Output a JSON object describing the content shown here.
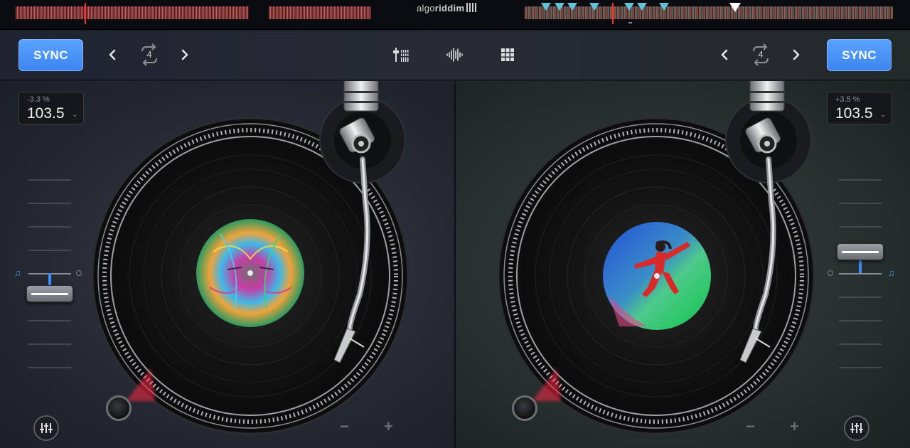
{
  "app": {
    "brand_light": "algo",
    "brand_bold": "riddim"
  },
  "colors": {
    "accent": "#3f8ef5",
    "sync": "#4a94fa",
    "playhead": "#ff2b2b",
    "cue": "#5fc4d8"
  },
  "left_deck": {
    "sync_label": "SYNC",
    "loop_value": "4",
    "pitch_percent": "-3.3 %",
    "bpm": "103.5",
    "artwork": "psychedelic-cat-artwork",
    "minus_label": "−",
    "plus_label": "+"
  },
  "right_deck": {
    "sync_label": "SYNC",
    "loop_value": "4",
    "pitch_percent": "+3.5 %",
    "bpm": "103.5",
    "artwork": "jumping-dancer-artwork",
    "minus_label": "−",
    "plus_label": "+"
  },
  "center_icons": [
    "mixer-faders-icon",
    "waveform-icon",
    "pads-grid-icon"
  ]
}
